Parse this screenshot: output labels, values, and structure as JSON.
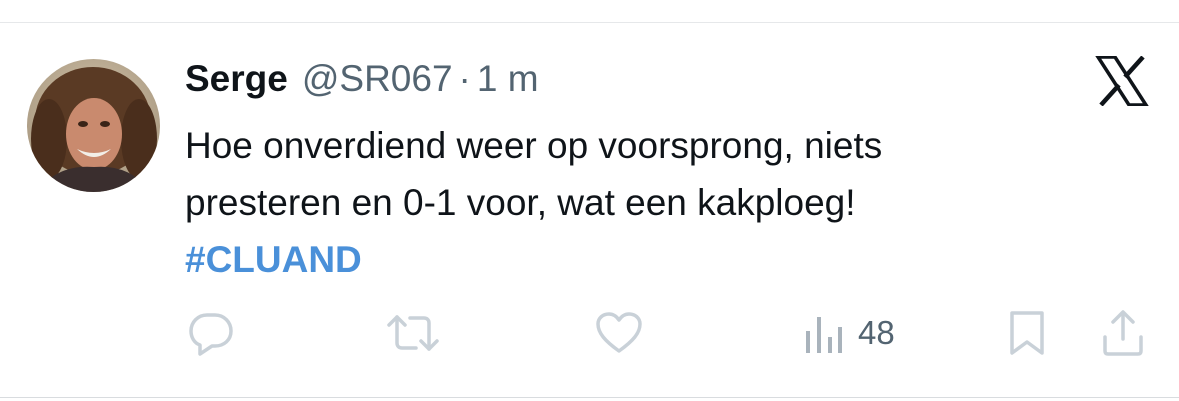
{
  "tweet": {
    "display_name": "Serge",
    "handle": "@SR067",
    "separator": "·",
    "timestamp": "1 m",
    "text_lines": [
      "Hoe onverdiend weer op voorsprong, niets",
      "presteren en 0-1 voor, wat een kakploeg!"
    ],
    "hashtag": "#CLUAND"
  },
  "actions": {
    "views_count": "48"
  },
  "icons": {
    "brand": "x-logo",
    "reply": "reply-icon",
    "retweet": "retweet-icon",
    "like": "heart-icon",
    "views": "views-chart-icon",
    "bookmark": "bookmark-icon",
    "share": "share-icon"
  },
  "colors": {
    "text": "#0f1419",
    "muted": "#536471",
    "hashtag": "#4a90d9",
    "action_icons": "#c9d1d8"
  }
}
